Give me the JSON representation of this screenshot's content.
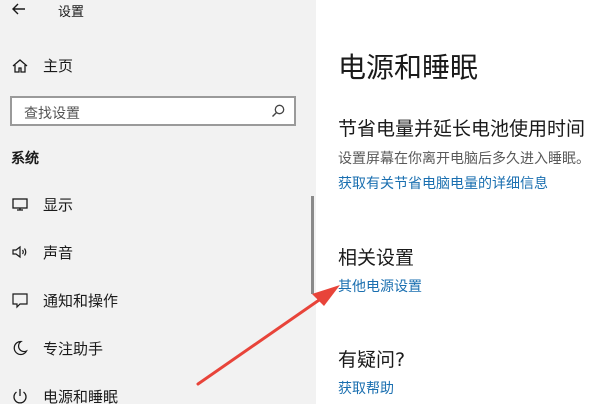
{
  "window": {
    "title": "设置"
  },
  "sidebar": {
    "home_label": "主页",
    "search_placeholder": "查找设置",
    "section_title": "系统",
    "items": [
      {
        "label": "显示",
        "icon": "monitor-icon"
      },
      {
        "label": "声音",
        "icon": "speaker-icon"
      },
      {
        "label": "通知和操作",
        "icon": "notification-icon"
      },
      {
        "label": "专注助手",
        "icon": "moon-icon"
      },
      {
        "label": "电源和睡眠",
        "icon": "power-icon"
      }
    ]
  },
  "main": {
    "page_title": "电源和睡眠",
    "save_power": {
      "heading": "节省电量并延长电池使用时间",
      "description": "设置屏幕在你离开电脑后多久进入睡眠。",
      "link": "获取有关节省电脑电量的详细信息"
    },
    "related": {
      "heading": "相关设置",
      "link": "其他电源设置"
    },
    "help": {
      "heading": "有疑问?",
      "link": "获取帮助"
    }
  },
  "colors": {
    "sidebar_bg": "#f2f2f2",
    "link": "#1a6fb0",
    "annotation_arrow": "#e8443a"
  }
}
